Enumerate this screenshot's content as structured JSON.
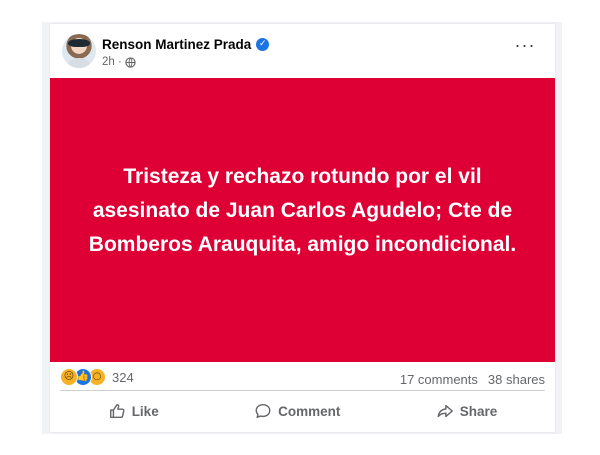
{
  "post": {
    "author": "Renson Martinez Prada",
    "verified_badge_icon": "verified-check-icon",
    "time": "2h ·",
    "audience_icon": "globe-icon",
    "more_label": "···",
    "text": "Tristeza y rechazo rotundo por el vil asesinato de Juan Carlos Agudelo; Cte de Bomberos Arauquita, amigo incondicional.",
    "background_color": "#de0035"
  },
  "stats": {
    "reaction_icons": [
      "sad-reaction-icon",
      "like-reaction-icon",
      "wow-reaction-icon"
    ],
    "reaction_count": "324",
    "comments": "17 comments",
    "shares": "38 shares"
  },
  "actions": {
    "like": "Like",
    "comment": "Comment",
    "share": "Share"
  },
  "colors": {
    "brand_blue": "#1b74e4",
    "muted_text": "#65676b"
  }
}
